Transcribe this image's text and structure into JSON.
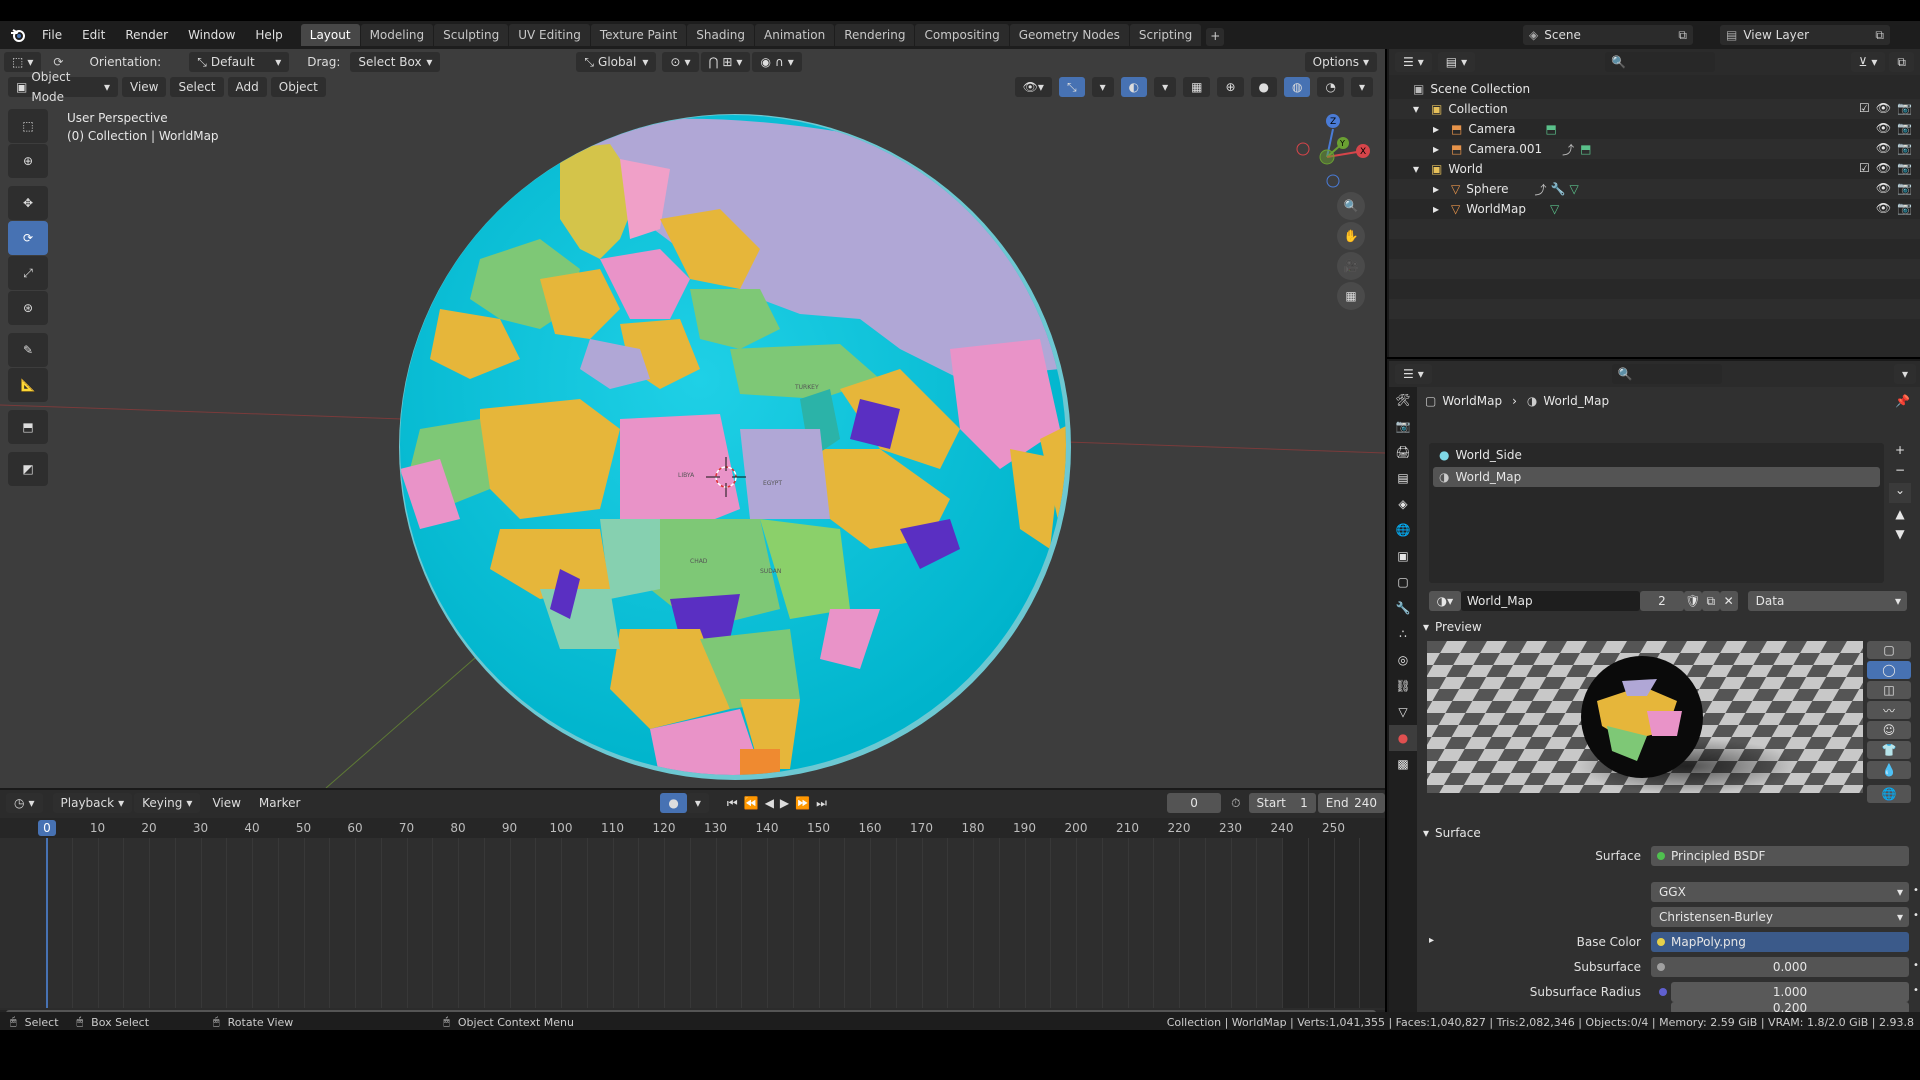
{
  "topbar": {
    "menus": [
      "File",
      "Edit",
      "Render",
      "Window",
      "Help"
    ],
    "tabs": [
      {
        "label": "Layout",
        "active": true
      },
      {
        "label": "Modeling"
      },
      {
        "label": "Sculpting"
      },
      {
        "label": "UV Editing"
      },
      {
        "label": "Texture Paint"
      },
      {
        "label": "Shading"
      },
      {
        "label": "Animation"
      },
      {
        "label": "Rendering"
      },
      {
        "label": "Compositing"
      },
      {
        "label": "Geometry Nodes"
      },
      {
        "label": "Scripting"
      }
    ],
    "add_tab": "+",
    "scene": "Scene",
    "view_layer": "View Layer"
  },
  "viewport": {
    "orientation_label": "Orientation:",
    "orientation_value": "Default",
    "drag_label": "Drag:",
    "drag_value": "Select Box",
    "transform_space": "Global",
    "options": "Options",
    "mode": "Object Mode",
    "menus": [
      "View",
      "Select",
      "Add",
      "Object"
    ],
    "info_line1": "User Perspective",
    "info_line2": "(0) Collection | WorldMap",
    "globe_labels": [
      "LIBYA",
      "EGYPT",
      "TURKEY",
      "SUDAN",
      "CHAD"
    ]
  },
  "timeline": {
    "playback": "Playback",
    "keying": "Keying",
    "view": "View",
    "marker": "Marker",
    "current_frame": "0",
    "start_label": "Start",
    "start_value": "1",
    "end_label": "End",
    "end_value": "240",
    "ruler": [
      "0",
      "10",
      "20",
      "30",
      "40",
      "50",
      "60",
      "70",
      "80",
      "90",
      "100",
      "110",
      "120",
      "130",
      "140",
      "150",
      "160",
      "170",
      "180",
      "190",
      "200",
      "210",
      "220",
      "230",
      "240",
      "250"
    ]
  },
  "outliner": {
    "root": "Scene Collection",
    "items": [
      {
        "name": "Collection",
        "level": 1
      },
      {
        "name": "Camera",
        "level": 2
      },
      {
        "name": "Camera.001",
        "level": 2
      },
      {
        "name": "World",
        "level": 1
      },
      {
        "name": "Sphere",
        "level": 2
      },
      {
        "name": "WorldMap",
        "level": 2
      }
    ]
  },
  "properties": {
    "breadcrumb_object": "WorldMap",
    "breadcrumb_material": "World_Map",
    "slots": [
      "World_Side",
      "World_Map"
    ],
    "material_name": "World_Map",
    "users": "2",
    "link": "Data",
    "preview_title": "Preview",
    "surface_title": "Surface",
    "surface_label": "Surface",
    "surface_value": "Principled BSDF",
    "distribution": "GGX",
    "subsurface_method": "Christensen-Burley",
    "base_color_label": "Base Color",
    "base_color_value": "MapPoly.png",
    "subsurface_label": "Subsurface",
    "subsurface_value": "0.000",
    "subsurface_radius_label": "Subsurface Radius",
    "subsurface_radius_1": "1.000",
    "subsurface_radius_2": "0.200"
  },
  "statusbar": {
    "select": "Select",
    "box_select": "Box Select",
    "rotate_view": "Rotate View",
    "context_menu": "Object Context Menu",
    "stats": "Collection | WorldMap | Verts:1,041,355 | Faces:1,040,827 | Tris:2,082,346 | Objects:0/4 | Memory: 2.59 GiB | VRAM: 1.8/2.0 GiB | 2.93.8"
  },
  "colors": {
    "accent": "#4772b3",
    "ocean": "#00bcd4",
    "background": "#3d3d3d"
  }
}
